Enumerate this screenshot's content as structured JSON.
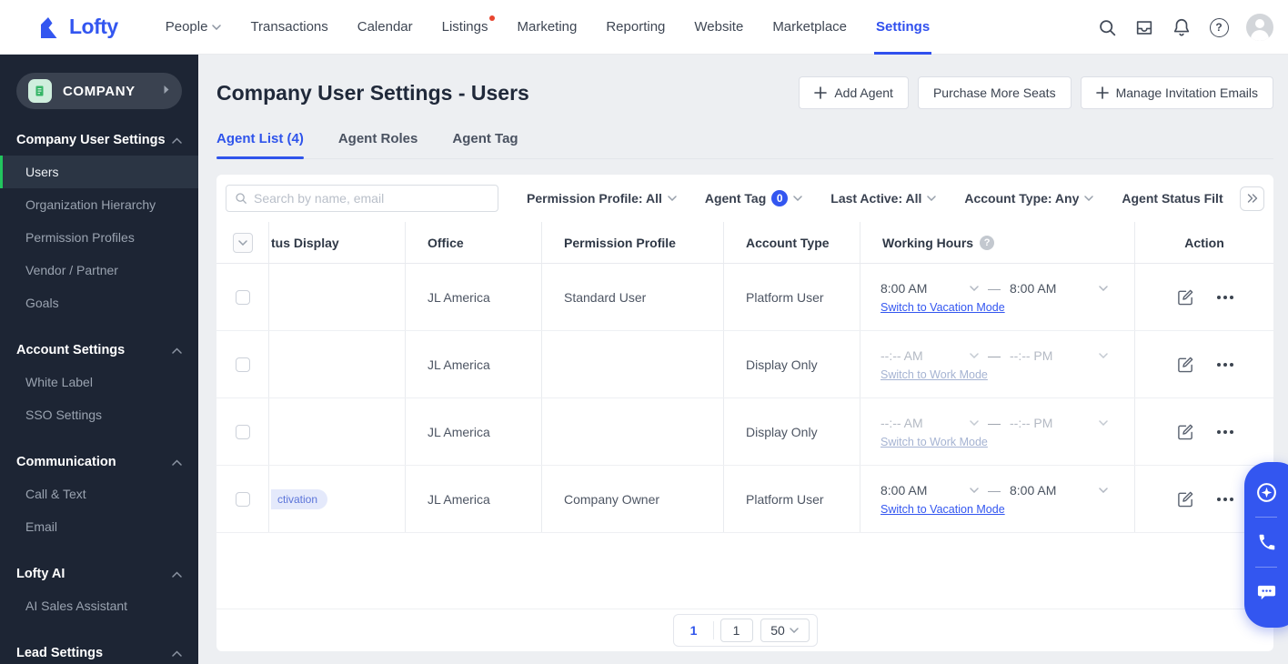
{
  "topnav": {
    "brand": "Lofty",
    "items": [
      {
        "label": "People"
      },
      {
        "label": "Transactions"
      },
      {
        "label": "Calendar"
      },
      {
        "label": "Listings"
      },
      {
        "label": "Marketing"
      },
      {
        "label": "Reporting"
      },
      {
        "label": "Website"
      },
      {
        "label": "Marketplace"
      },
      {
        "label": "Settings"
      }
    ],
    "active_item": "Settings",
    "help_glyph": "?"
  },
  "sidebar": {
    "company": {
      "label": "COMPANY"
    },
    "sections": [
      {
        "title": "Company User Settings",
        "items": [
          {
            "label": "Users"
          },
          {
            "label": "Organization Hierarchy"
          },
          {
            "label": "Permission Profiles"
          },
          {
            "label": "Vendor / Partner"
          },
          {
            "label": "Goals"
          }
        ],
        "active_item": "Users"
      },
      {
        "title": "Account Settings",
        "items": [
          {
            "label": "White Label"
          },
          {
            "label": "SSO Settings"
          }
        ]
      },
      {
        "title": "Communication",
        "items": [
          {
            "label": "Call & Text"
          },
          {
            "label": "Email"
          }
        ]
      },
      {
        "title": "Lofty AI",
        "items": [
          {
            "label": "AI Sales Assistant"
          }
        ]
      },
      {
        "title": "Lead Settings",
        "items": []
      }
    ]
  },
  "header": {
    "title": "Company User Settings - Users",
    "add_agent": "Add Agent",
    "purchase_seats": "Purchase More Seats",
    "manage_invites": "Manage Invitation Emails"
  },
  "tabs": [
    {
      "label": "Agent List (4)"
    },
    {
      "label": "Agent Roles"
    },
    {
      "label": "Agent Tag"
    }
  ],
  "active_tab": "Agent List (4)",
  "filters": {
    "search_placeholder": "Search by name, email",
    "permission_profile": "Permission Profile: All",
    "agent_tag": "Agent Tag",
    "agent_tag_count": "0",
    "last_active": "Last Active: All",
    "account_type": "Account Type: Any",
    "agent_status": "Agent Status Filt"
  },
  "table": {
    "columns": {
      "status": "tus Display",
      "office": "Office",
      "permission": "Permission Profile",
      "account": "Account Type",
      "hours": "Working Hours",
      "action": "Action"
    },
    "hours_help_glyph": "?",
    "time_separator": "—",
    "rows": [
      {
        "status": "",
        "office": "JL America",
        "permission": "Standard User",
        "account": "Platform User",
        "start": "8:00 AM",
        "end": "8:00 AM",
        "link": "Switch to Vacation Mode"
      },
      {
        "status": "",
        "office": "JL America",
        "permission": "",
        "account": "Display Only",
        "start": "--:-- AM",
        "end": "--:-- PM",
        "link": "Switch to Work Mode"
      },
      {
        "status": "",
        "office": "JL America",
        "permission": "",
        "account": "Display Only",
        "start": "--:-- AM",
        "end": "--:-- PM",
        "link": "Switch to Work Mode"
      },
      {
        "status": "ctivation",
        "office": "JL America",
        "permission": "Company Owner",
        "account": "Platform User",
        "start": "8:00 AM",
        "end": "8:00 AM",
        "link": "Switch to Vacation Mode"
      }
    ]
  },
  "pagination": {
    "current_page": "1",
    "page_input": "1",
    "page_size": "50"
  },
  "colors": {
    "accent_blue": "#3356f0",
    "sidebar_bg": "#1d2534",
    "active_green": "#22c55e",
    "badge_bg": "#e4e9fb",
    "badge_text": "#5b74d9"
  }
}
